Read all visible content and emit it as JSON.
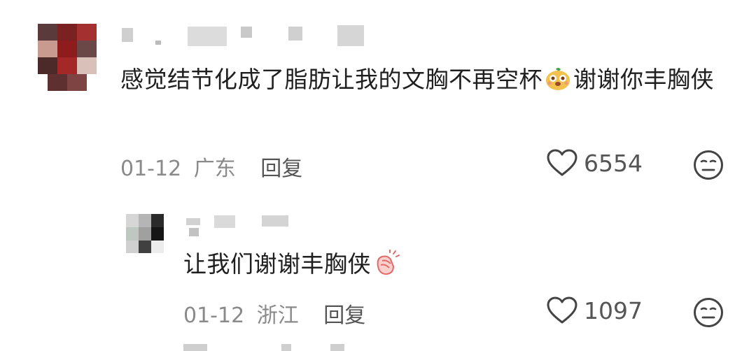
{
  "comments": [
    {
      "text": "感觉结节化成了脂肪让我的文胸不再空杯",
      "text_after": "谢谢你丰胸侠",
      "date": "01-12",
      "location": "广东",
      "reply_label": "回复",
      "likes": "6554",
      "emoji": "face-emoji"
    },
    {
      "text": "让我们谢谢丰胸侠",
      "date": "01-12",
      "location": "浙江",
      "reply_label": "回复",
      "likes": "1097",
      "emoji": "clap-emoji"
    }
  ],
  "icons": {
    "like": "heart-outline-icon",
    "dislike": "meh-face-icon"
  }
}
